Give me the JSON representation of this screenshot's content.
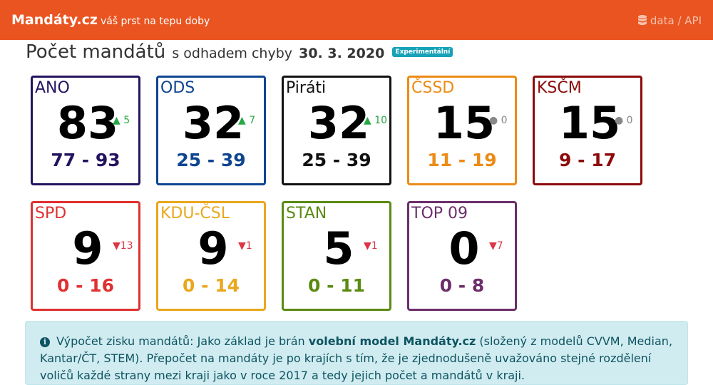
{
  "navbar": {
    "brand": "Mandáty.cz",
    "tagline": "váš prst na tepu doby",
    "right_link": "data / API",
    "db_icon": "database-icon"
  },
  "heading": {
    "title": "Počet mandátů",
    "subtitle": "s odhadem chyby",
    "date": "30. 3. 2020",
    "badge": "Experimentální"
  },
  "parties": [
    {
      "name": "ANO",
      "seats": "83",
      "change": "▲ 5",
      "dir": "up",
      "range": "77 - 93",
      "color": "#24135f"
    },
    {
      "name": "ODS",
      "seats": "32",
      "change": "▲ 7",
      "dir": "up",
      "range": "25 - 39",
      "color": "#0e4591"
    },
    {
      "name": "Piráti",
      "seats": "32",
      "change": "▲ 10",
      "dir": "up",
      "range": "25 - 39",
      "color": "#111111"
    },
    {
      "name": "ČSSD",
      "seats": "15",
      "change": "● 0",
      "dir": "same",
      "range": "11 - 19",
      "color": "#ec8b16"
    },
    {
      "name": "KSČM",
      "seats": "15",
      "change": "● 0",
      "dir": "same",
      "range": "9 - 17",
      "color": "#8c0b0b"
    },
    {
      "name": "SPD",
      "seats": "9",
      "change": "▼13",
      "dir": "down",
      "range": "0 - 16",
      "color": "#e03030"
    },
    {
      "name": "KDU-ČSL",
      "seats": "9",
      "change": "▼1",
      "dir": "down",
      "range": "0 - 14",
      "color": "#eaa71d"
    },
    {
      "name": "STAN",
      "seats": "5",
      "change": "▼1",
      "dir": "down",
      "range": "0 - 11",
      "color": "#5b8a11"
    },
    {
      "name": "TOP 09",
      "seats": "0",
      "change": "▼7",
      "dir": "down",
      "range": "0 - 8",
      "color": "#6c2e6b"
    }
  ],
  "info": {
    "icon": "info-circle-icon",
    "lead": "Výpočet zisku mandátů: Jako základ je brán",
    "bold": "volební model Mandáty.cz",
    "rest": "(složený z modelů CVVM, Median, Kantar/ČT, STEM). Přepočet na mandáty je po krajích s tím, že je zjednodušeně uvažováno stejné rozdělení voličů každé strany mezi kraji jako v roce 2017 a tedy jejich počet a mandátů v kraji."
  }
}
